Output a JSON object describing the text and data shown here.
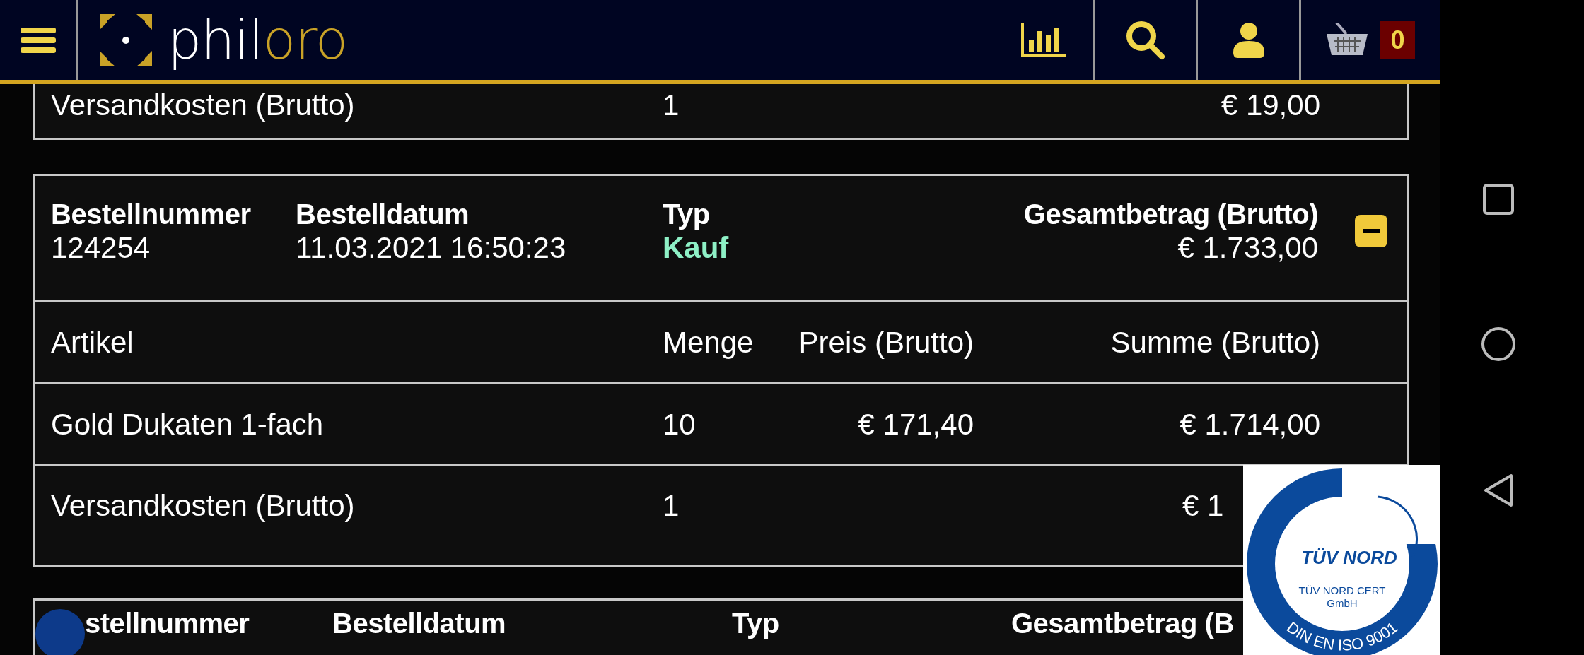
{
  "header": {
    "logo": [
      "phil",
      "oro"
    ],
    "cart_count": "0"
  },
  "previous_order": {
    "rows": [
      {
        "article": "Versandkosten (Brutto)",
        "quantity": "1",
        "total": "€ 19,00"
      }
    ]
  },
  "order": {
    "number_label": "Bestellnummer",
    "number": "124254",
    "date_label": "Bestelldatum",
    "date": "11.03.2021 16:50:23",
    "type_label": "Typ",
    "type": "Kauf",
    "total_label": "Gesamtbetrag (Brutto)",
    "total": "€ 1.733,00",
    "expanded": true,
    "columns": [
      "Artikel",
      "Menge",
      "Preis (Brutto)",
      "Summe (Brutto)"
    ],
    "rows": [
      {
        "article": "Gold Dukaten 1-fach",
        "quantity": "10",
        "price": "€ 171,40",
        "total": "€ 1.714,00"
      },
      {
        "article": "Versandkosten (Brutto)",
        "quantity": "1",
        "total": "€ 1"
      }
    ]
  },
  "next_order": {
    "labels": [
      "stellnummer",
      "Bestelldatum",
      "Typ",
      "Gesamtbetrag (B"
    ]
  },
  "certificate_badge": {
    "brand": "TÜV NORD",
    "line_1": "TÜV NORD CERT",
    "line_2": "GmbH",
    "arc_text": "DIN EN ISO 9001"
  }
}
